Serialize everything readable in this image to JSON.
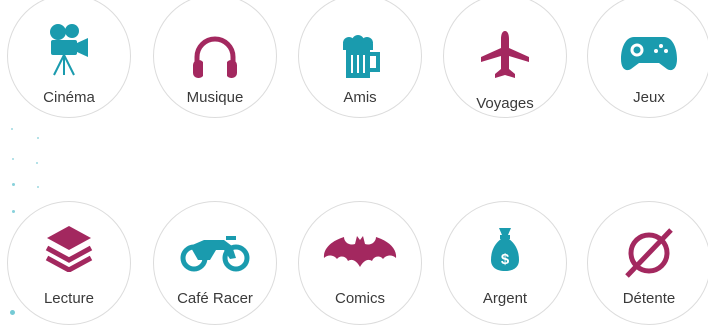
{
  "colors": {
    "teal": "#1a9bae",
    "magenta": "#a3285f",
    "ring": "#dcdcdc"
  },
  "interests": [
    {
      "label": "Cinéma",
      "icon": "movie-camera-icon"
    },
    {
      "label": "Musique",
      "icon": "headphones-icon"
    },
    {
      "label": "Amis",
      "icon": "beer-mug-icon"
    },
    {
      "label": "Voyages",
      "icon": "airplane-icon"
    },
    {
      "label": "Jeux",
      "icon": "gamepad-icon"
    },
    {
      "label": "Lecture",
      "icon": "stacked-layers-icon"
    },
    {
      "label": "Café Racer",
      "icon": "motorcycle-icon"
    },
    {
      "label": "Comics",
      "icon": "bat-symbol-icon"
    },
    {
      "label": "Argent",
      "icon": "money-bag-icon"
    },
    {
      "label": "Détente",
      "icon": "empty-set-icon"
    }
  ]
}
